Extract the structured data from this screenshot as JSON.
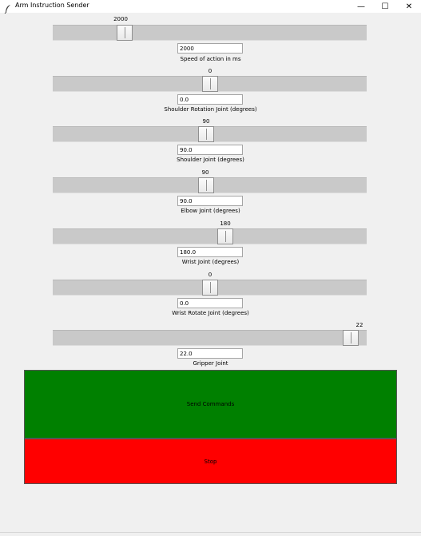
{
  "window": {
    "title": "Arm Instruction Sender",
    "minimize_glyph": "—",
    "maximize_glyph": "☐",
    "close_glyph": "✕",
    "icon": "feather-icon"
  },
  "controls": [
    {
      "id": "speed",
      "value_label": "2000",
      "entry_value": "2000",
      "label": "Speed of action in ms",
      "fraction": 0.215
    },
    {
      "id": "shoulder-rot",
      "value_label": "0",
      "entry_value": "0.0",
      "label": "Shoulder Rotation Joint (degrees)",
      "fraction": 0.5
    },
    {
      "id": "shoulder",
      "value_label": "90",
      "entry_value": "90.0",
      "label": "Shoulder Joint (degrees)",
      "fraction": 0.487
    },
    {
      "id": "elbow",
      "value_label": "90",
      "entry_value": "90.0",
      "label": "Elbow Joint (degrees)",
      "fraction": 0.487
    },
    {
      "id": "wrist",
      "value_label": "180",
      "entry_value": "180.0",
      "label": "Wrist Joint (degrees)",
      "fraction": 0.551
    },
    {
      "id": "wrist-rotate",
      "value_label": "0",
      "entry_value": "0.0",
      "label": "Wrist Rotate Joint (degrees)",
      "fraction": 0.5
    },
    {
      "id": "gripper",
      "value_label": "22",
      "entry_value": "22.0",
      "label": "Gripper Joint",
      "fraction": 0.974
    }
  ],
  "buttons": {
    "send_label": "Send Commands",
    "stop_label": "Stop"
  },
  "colors": {
    "send": "#008000",
    "stop": "#ff0000",
    "trough": "#c9c9c9",
    "background": "#f0f0f0"
  }
}
